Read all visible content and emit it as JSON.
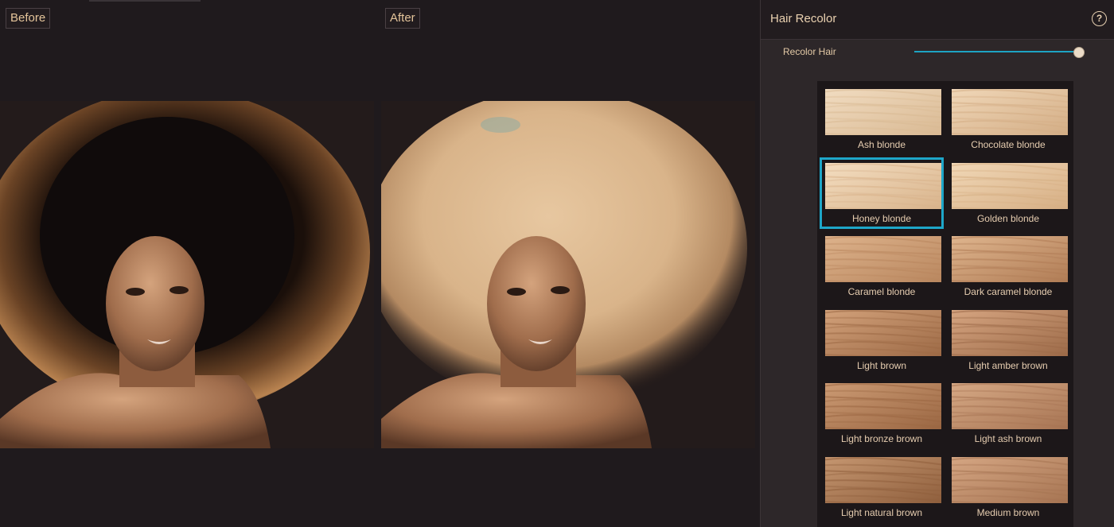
{
  "views": {
    "before_label": "Before",
    "after_label": "After"
  },
  "panel": {
    "title": "Hair Recolor",
    "help_icon": "?",
    "slider": {
      "label": "Recolor Hair",
      "value_fraction": 1.0,
      "accent": "#1ea7c9"
    }
  },
  "swatches": [
    {
      "label": "Ash blonde",
      "colors": [
        "#f1dcc1",
        "#d9b993"
      ],
      "selected": false
    },
    {
      "label": "Chocolate blonde",
      "colors": [
        "#f0d7b8",
        "#d3ad85"
      ],
      "selected": false
    },
    {
      "label": "Honey blonde",
      "colors": [
        "#f4dec1",
        "#d8b38b"
      ],
      "selected": true
    },
    {
      "label": "Golden blonde",
      "colors": [
        "#f1d8b7",
        "#d6ae84"
      ],
      "selected": false
    },
    {
      "label": "Caramel blonde",
      "colors": [
        "#ddb28b",
        "#b9875f"
      ],
      "selected": false
    },
    {
      "label": "Dark caramel blonde",
      "colors": [
        "#dfb58e",
        "#b07c55"
      ],
      "selected": false
    },
    {
      "label": "Light brown",
      "colors": [
        "#d2a17a",
        "#9d6a46"
      ],
      "selected": false
    },
    {
      "label": "Light amber brown",
      "colors": [
        "#d6a581",
        "#9c6a48"
      ],
      "selected": false
    },
    {
      "label": "Light bronze brown",
      "colors": [
        "#cc9b74",
        "#9a6642"
      ],
      "selected": false
    },
    {
      "label": "Light ash brown",
      "colors": [
        "#d6a985",
        "#a77453"
      ],
      "selected": false
    },
    {
      "label": "Light natural brown",
      "colors": [
        "#c59670",
        "#8f5f3d"
      ],
      "selected": false
    },
    {
      "label": "Medium brown",
      "colors": [
        "#d5a683",
        "#a67452"
      ],
      "selected": false
    }
  ]
}
